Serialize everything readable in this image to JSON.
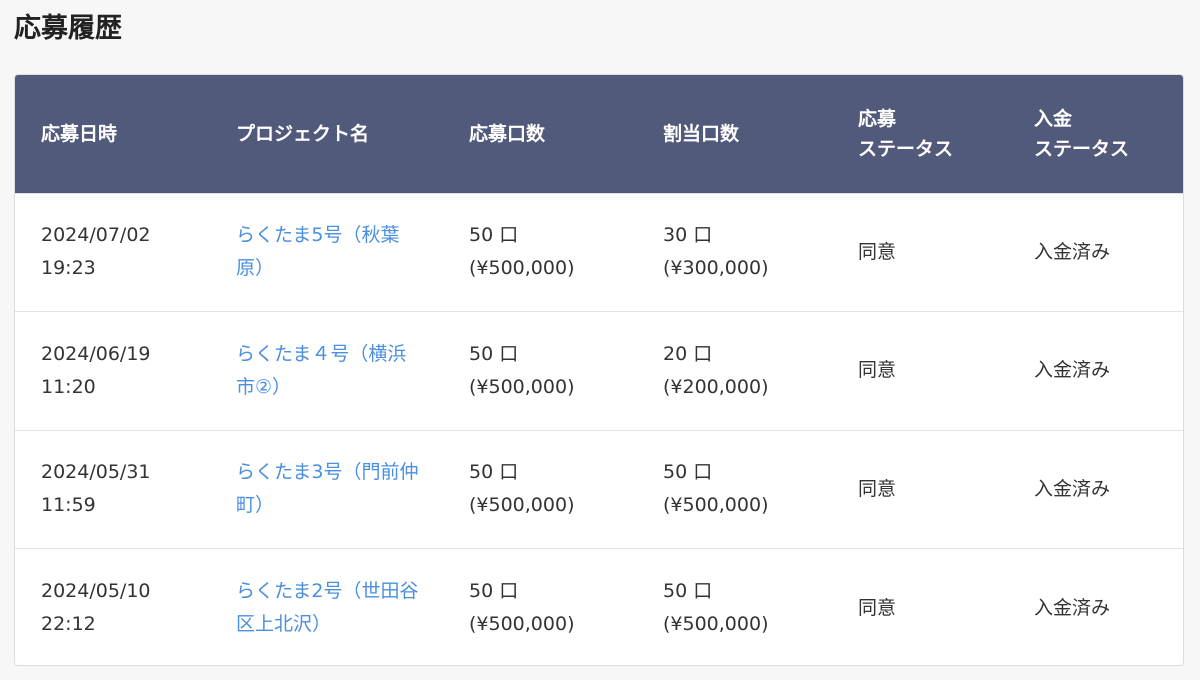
{
  "page": {
    "title": "応募履歴"
  },
  "table": {
    "headers": {
      "date": [
        "応募日時"
      ],
      "project": [
        "プロジェクト名"
      ],
      "applied_units": [
        "応募口数"
      ],
      "allocated_units": [
        "割当口数"
      ],
      "application_status": [
        "応募",
        "ステータス"
      ],
      "payment_status": [
        "入金",
        "ステータス"
      ]
    },
    "rows": [
      {
        "date": "2024/07/02",
        "time": "19:23",
        "project": "らくたま5号（秋葉原）",
        "applied_units": "50 口",
        "applied_amount": "(¥500,000)",
        "allocated_units": "30 口",
        "allocated_amount": "(¥300,000)",
        "application_status": "同意",
        "payment_status": "入金済み"
      },
      {
        "date": "2024/06/19",
        "time": "11:20",
        "project": "らくたま４号（横浜市②）",
        "applied_units": "50 口",
        "applied_amount": "(¥500,000)",
        "allocated_units": "20 口",
        "allocated_amount": "(¥200,000)",
        "application_status": "同意",
        "payment_status": "入金済み"
      },
      {
        "date": "2024/05/31",
        "time": "11:59",
        "project": "らくたま3号（門前仲町）",
        "applied_units": "50 口",
        "applied_amount": "(¥500,000)",
        "allocated_units": "50 口",
        "allocated_amount": "(¥500,000)",
        "application_status": "同意",
        "payment_status": "入金済み"
      },
      {
        "date": "2024/05/10",
        "time": "22:12",
        "project": "らくたま2号（世田谷区上北沢）",
        "applied_units": "50 口",
        "applied_amount": "(¥500,000)",
        "allocated_units": "50 口",
        "allocated_amount": "(¥500,000)",
        "application_status": "同意",
        "payment_status": "入金済み"
      }
    ]
  },
  "colors": {
    "header_bg": "#525a7c",
    "link": "#4a8fe0",
    "text": "#333333"
  }
}
